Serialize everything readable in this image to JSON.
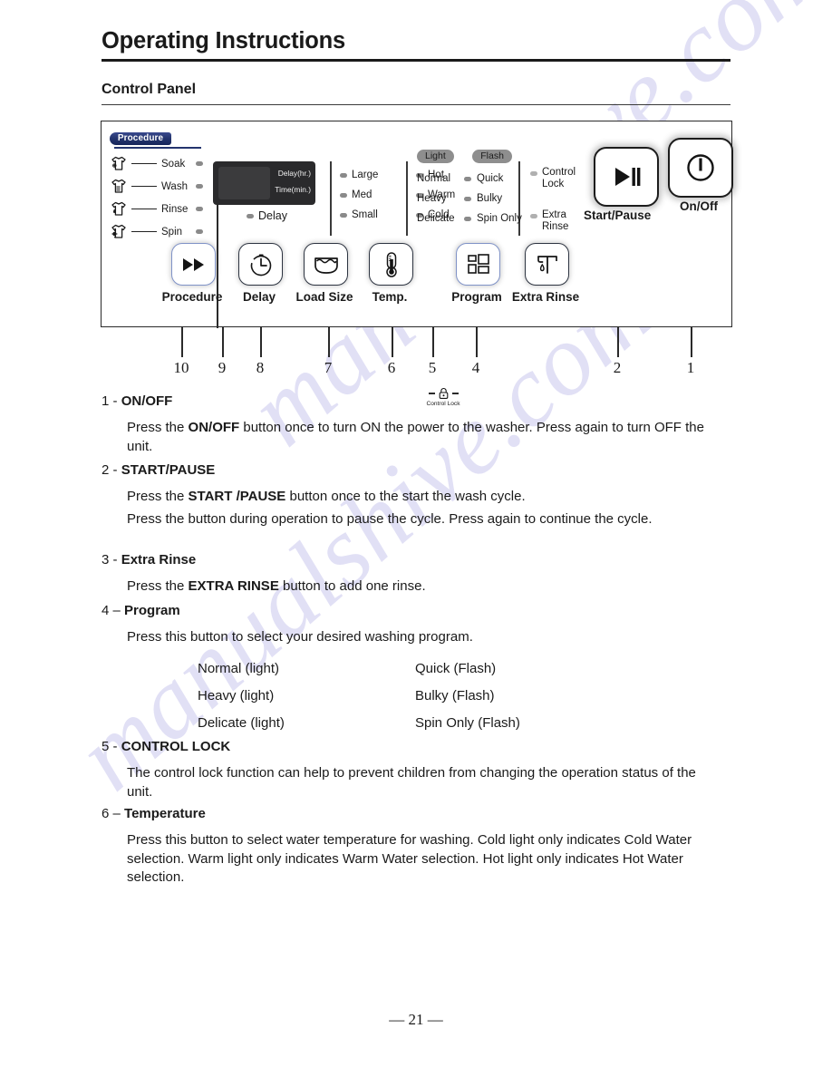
{
  "document": {
    "title": "Operating Instructions",
    "section_title": "Control Panel",
    "page_number": "— 21 —",
    "watermark": "manualshive.com"
  },
  "control_panel": {
    "procedure": {
      "tag_label": "Procedure",
      "steps": [
        {
          "label": "Soak",
          "icon": "garment-soak-icon"
        },
        {
          "label": "Wash",
          "icon": "garment-wash-icon"
        },
        {
          "label": "Rinse",
          "icon": "garment-rinse-icon"
        },
        {
          "label": "Spin",
          "icon": "garment-spin-icon"
        }
      ]
    },
    "display": {
      "delay_hr_label": "Delay(hr.)",
      "time_min_label": "Time(min.)",
      "delay_led_label": "Delay"
    },
    "load_size": {
      "options": [
        "Large",
        "Med",
        "Small"
      ]
    },
    "temperature": {
      "options": [
        "Hot",
        "Warm",
        "Cold"
      ]
    },
    "program": {
      "light_pill": "Light",
      "flash_pill": "Flash",
      "rows": [
        {
          "light": "Normal",
          "flash": "Quick"
        },
        {
          "light": "Heavy",
          "flash": "Bulky"
        },
        {
          "light": "Delicate",
          "flash": "Spin Only"
        }
      ]
    },
    "status_leds": [
      {
        "line1": "Control",
        "line2": "Lock"
      },
      {
        "line1": "Extra",
        "line2": "Rinse"
      }
    ],
    "big_buttons": [
      {
        "name": "start-pause",
        "label": "Start/Pause",
        "icon": "play-pause-icon"
      },
      {
        "name": "on-off",
        "label": "On/Off",
        "icon": "power-icon"
      }
    ],
    "control_lock_mini": {
      "label": "Control Lock",
      "icon": "padlock-icon"
    },
    "buttons": [
      {
        "name": "procedure",
        "label": "Procedure",
        "icon": "fast-forward-icon",
        "accent": true
      },
      {
        "name": "delay",
        "label": "Delay",
        "icon": "clock-timer-icon",
        "accent": false
      },
      {
        "name": "load-size",
        "label": "Load Size",
        "icon": "water-basin-icon",
        "accent": false
      },
      {
        "name": "temp",
        "label": "Temp.",
        "icon": "thermometer-icon",
        "accent": false
      },
      {
        "name": "program",
        "label": "Program",
        "icon": "squares-grid-icon",
        "accent": true
      },
      {
        "name": "extra-rinse",
        "label": "Extra Rinse",
        "icon": "faucet-drop-icon",
        "accent": false
      }
    ],
    "callout_numbers": [
      "10",
      "9",
      "8",
      "7",
      "6",
      "5",
      "4",
      "2",
      "1"
    ]
  },
  "sections": [
    {
      "number": "1",
      "dash": "-",
      "name": "ON/OFF",
      "body_html": "Press the <b>ON/OFF</b> button once to turn ON the power to the washer. Press again to turn OFF the unit."
    },
    {
      "number": "2",
      "dash": "-",
      "name": "START/PAUSE",
      "body_html": "Press the <b>START /PAUSE</b> button once to the start the wash cycle.",
      "body_html_2": "Press the button during operation to pause the cycle. Press again to continue the cycle."
    },
    {
      "number": "3",
      "dash": "-",
      "name": "Extra Rinse",
      "body_html": "Press the <b>EXTRA RINSE</b> button to add one rinse."
    },
    {
      "number": "4",
      "dash": "–",
      "name": "Program",
      "body_html": "Press this button to select your desired washing program.",
      "program_table": [
        {
          "light": "Normal (light)",
          "flash": "Quick (Flash)"
        },
        {
          "light": "Heavy (light)",
          "flash": "Bulky (Flash)"
        },
        {
          "light": "Delicate (light)",
          "flash": "Spin Only (Flash)"
        }
      ]
    },
    {
      "number": "5",
      "dash": "-",
      "name": "CONTROL LOCK",
      "body_html": "The control lock function can help to prevent children from changing the operation status of the unit."
    },
    {
      "number": "6",
      "dash": "–",
      "name": "Temperature",
      "body_html": "Press this button to select water temperature for washing. Cold light only indicates Cold Water selection. Warm light only indicates Warm Water selection. Hot light only indicates Hot Water selection."
    }
  ]
}
